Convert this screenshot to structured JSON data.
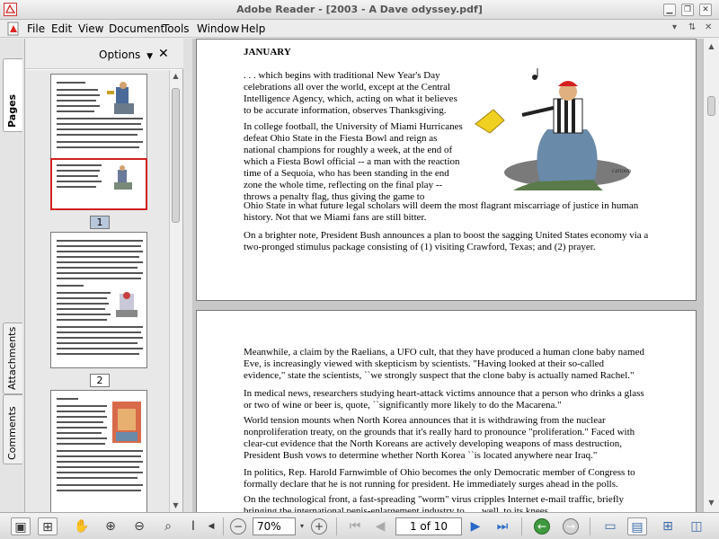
{
  "window": {
    "title": "Adobe Reader - [2003 - A Dave odyssey.pdf]"
  },
  "menu": {
    "items": [
      "File",
      "Edit",
      "View",
      "Document",
      "Tools",
      "Window",
      "Help"
    ]
  },
  "nav_tabs": [
    "Pages",
    "Attachments",
    "Comments"
  ],
  "thumbnails": {
    "options_label": "Options",
    "close_glyph": "✕",
    "pages": [
      {
        "label": "1",
        "selected": true
      },
      {
        "label": "2",
        "selected": false
      }
    ]
  },
  "document": {
    "page1": {
      "heading": "JANUARY",
      "p1": ". . . which begins with traditional New Year's Day celebrations all over the world, except at the Central Intelligence Agency, which, acting on what it believes to be accurate information, observes Thanksgiving.",
      "p2a": "In college football, the University of Miami Hurricanes defeat Ohio State in the Fiesta Bowl and reign as national champions for roughly a week, at the end of which a Fiesta Bowl official -- a man with the reaction time of a Sequoia, who has been standing in the end zone the whole time, reflecting on the final play -- throws a penalty flag, thus giving the game to",
      "p2b": "Ohio State in what future legal scholars will deem the most flagrant miscarriage of justice in human history. Not that we Miami fans are still bitter.",
      "p3": "On a brighter note, President Bush announces a plan to boost the sagging United States economy via a two-pronged stimulus package consisting of (1) visiting Crawford, Texas; and (2) prayer."
    },
    "page2": {
      "p1": "Meanwhile, a claim by the Raelians, a UFO cult, that they have produced a human clone baby named Eve, is increasingly viewed with skepticism by scientists. \"Having looked at their so-called evidence,\" state the scientists, ``we strongly suspect that the clone baby is actually named Rachel.\"",
      "p2": "In medical news, researchers studying heart-attack victims announce that a person who drinks a glass or two of wine or beer is, quote, ``significantly more likely to do the Macarena.\"",
      "p3": "World tension mounts when North Korea announces that it is withdrawing from the nuclear nonproliferation treaty, on the grounds that it's really hard to pronounce \"proliferation.\" Faced with clear-cut evidence that the North Koreans are actively developing weapons of mass destruction, President Bush vows to determine whether North Korea ``is located anywhere near Iraq.\"",
      "p4": "In politics, Rep. Harold Farnwimble of Ohio becomes the only Democratic member of Congress to formally declare that he is not running for president. He immediately surges ahead in the polls.",
      "p5": "On the technological front, a fast-spreading \"worm\" virus cripples Internet e-mail traffic, briefly bringing the international penis-enlargement industry to . . . well, to its knees."
    }
  },
  "toolbar": {
    "zoom_value": "70%",
    "page_value": "1 of 10"
  },
  "colors": {
    "accent_green": "#3f9a3f",
    "selection_red": "#d02020",
    "selected_label": "#b8c8dc"
  }
}
